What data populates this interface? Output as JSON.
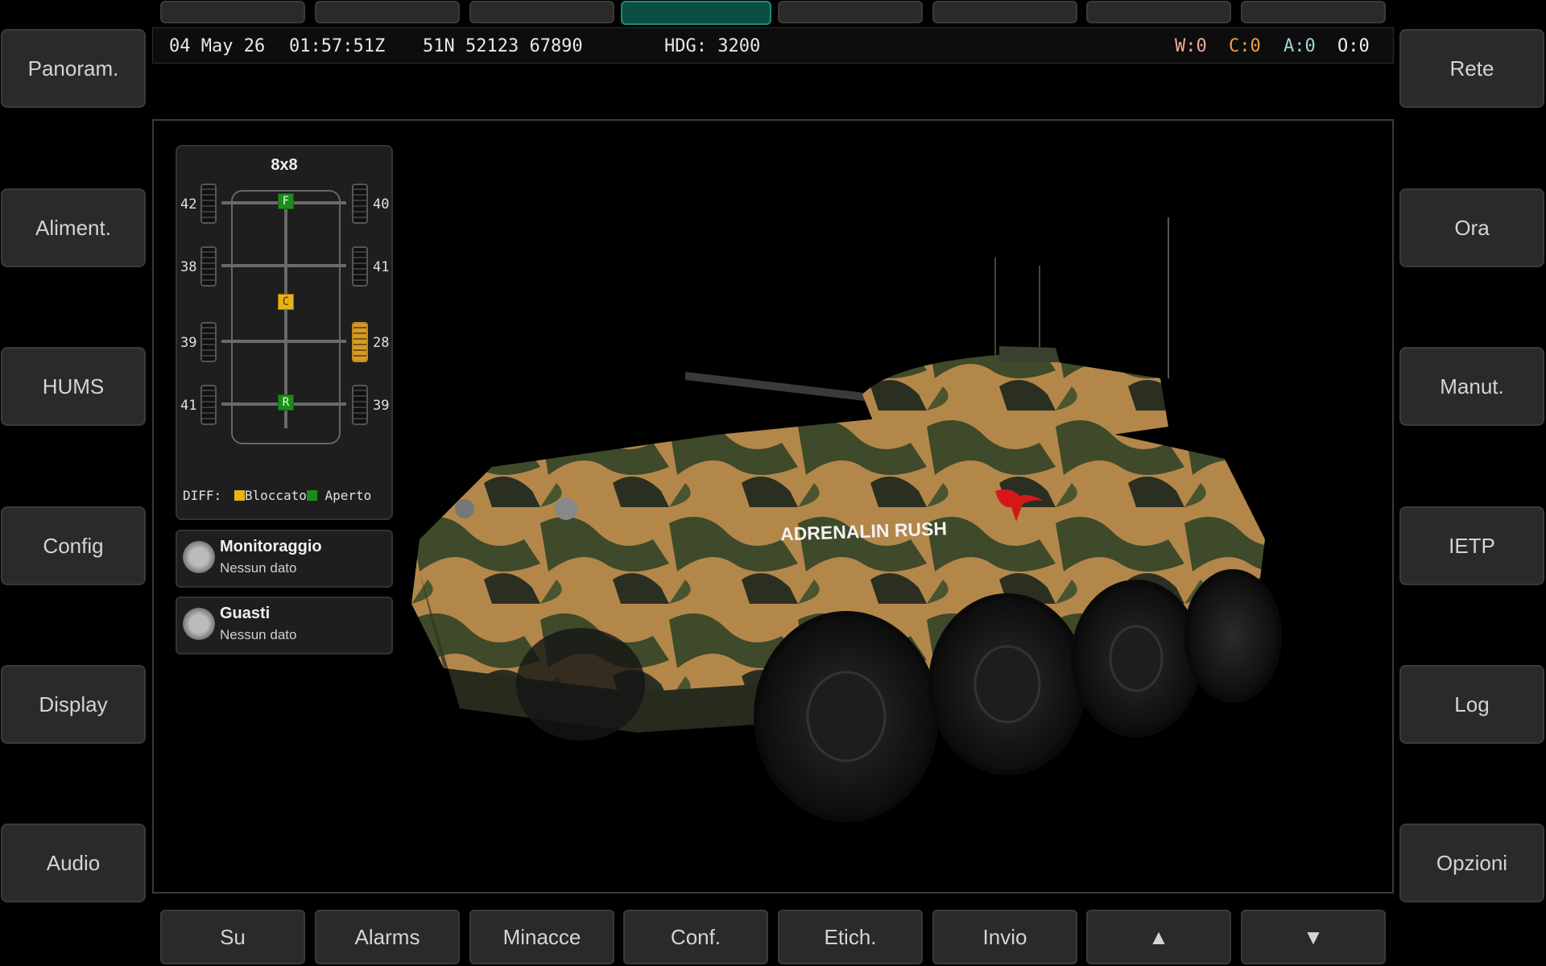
{
  "left_menu": [
    "Panoram.",
    "Aliment.",
    "HUMS",
    "Config",
    "Display",
    "Audio"
  ],
  "right_menu": [
    "Rete",
    "Ora",
    "Manut.",
    "IETP",
    "Log",
    "Opzioni"
  ],
  "bottom_menu": [
    "Su",
    "Alarms",
    "Minacce",
    "Conf.",
    "Etich.",
    "Invio",
    "▲",
    "▼"
  ],
  "top_tabs": {
    "count": 8,
    "active_index": 3
  },
  "status_bar": {
    "date": "04 May 26",
    "time": "01:57:51Z",
    "grid": "51N 52123 67890",
    "heading": "HDG: 3200",
    "counters": [
      {
        "label": "W:0",
        "color": "#f2a99a"
      },
      {
        "label": "C:0",
        "color": "#f0a040"
      },
      {
        "label": "A:0",
        "color": "#9fd6d6"
      },
      {
        "label": "O:0",
        "color": "#f0f0f0"
      }
    ]
  },
  "drive_panel": {
    "title": "8x8",
    "left_wheels": [
      "42",
      "38",
      "39",
      "41"
    ],
    "right_wheels": [
      "40",
      "41",
      "28",
      "39"
    ],
    "diffs": [
      {
        "label": "F",
        "state": "open"
      },
      {
        "label": "C",
        "state": "locked"
      },
      {
        "label": "R",
        "state": "open"
      }
    ],
    "diff_label": "DIFF:",
    "legend_locked": "Bloccato",
    "legend_open": "Aperto",
    "colors": {
      "locked": "#e5b319",
      "open": "#1c8c1c",
      "warn_wheel": "#d39b2a"
    }
  },
  "monitoring": {
    "title": "Monitoraggio",
    "status": "Nessun dato"
  },
  "faults": {
    "title": "Guasti",
    "status": "Nessun dato"
  },
  "vehicle": {
    "marking": "ADRENALIN RUSH"
  }
}
